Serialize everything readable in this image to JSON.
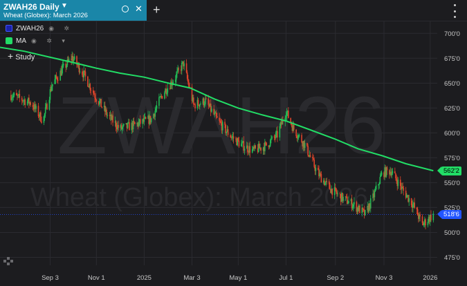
{
  "tab": {
    "title": "ZWAH26 Daily",
    "subtitle": "Wheat (Globex): March 2026",
    "caret": "▼",
    "close": "✕",
    "add": "+"
  },
  "legend": [
    {
      "label": "ZWAH26",
      "color": "#2233ee"
    },
    {
      "label": "MA",
      "color": "#22dd66"
    }
  ],
  "study_label": "Study",
  "watermark": {
    "symbol": "ZWAH26",
    "description": "Wheat (Globex): March 2026"
  },
  "badges": {
    "ma": {
      "value": "562'2",
      "color": "#22dd66"
    },
    "price": {
      "value": "518'6",
      "color": "#2255ff"
    }
  },
  "colors": {
    "up": "#22bb55",
    "down": "#e0452b",
    "ma": "#22dd66",
    "grid": "#2b2b30",
    "axis_text": "#c8c8c8"
  },
  "chart_data": {
    "type": "candlestick",
    "y_ticks": [
      "700'0",
      "675'0",
      "650'0",
      "625'0",
      "600'0",
      "575'0",
      "550'0",
      "525'0",
      "500'0",
      "475'0"
    ],
    "y_tick_values": [
      700,
      675,
      650,
      625,
      600,
      575,
      550,
      525,
      500,
      475
    ],
    "ylim": [
      467,
      712
    ],
    "x_ticks": [
      "Sep 3",
      "Nov 1",
      "2025",
      "Mar 3",
      "May 1",
      "Jul 1",
      "Sep 2",
      "Nov 3",
      "2026"
    ],
    "x_tick_dates": [
      "2024-09-03",
      "2024-11-01",
      "2025-01-01",
      "2025-03-03",
      "2025-05-01",
      "2025-07-01",
      "2025-09-02",
      "2025-11-03",
      "2026-01-01"
    ],
    "x_range": [
      "2024-07-01",
      "2026-01-10"
    ],
    "price_anchors": [
      [
        "2024-07-15",
        638
      ],
      [
        "2024-08-10",
        630
      ],
      [
        "2024-08-25",
        612
      ],
      [
        "2024-09-05",
        648
      ],
      [
        "2024-09-20",
        665
      ],
      [
        "2024-10-01",
        676
      ],
      [
        "2024-10-15",
        660
      ],
      [
        "2024-10-30",
        638
      ],
      [
        "2024-11-15",
        618
      ],
      [
        "2024-12-01",
        604
      ],
      [
        "2024-12-20",
        608
      ],
      [
        "2025-01-10",
        614
      ],
      [
        "2025-01-25",
        640
      ],
      [
        "2025-02-10",
        656
      ],
      [
        "2025-02-20",
        670
      ],
      [
        "2025-03-05",
        628
      ],
      [
        "2025-03-20",
        632
      ],
      [
        "2025-04-05",
        612
      ],
      [
        "2025-04-20",
        598
      ],
      [
        "2025-05-05",
        588
      ],
      [
        "2025-05-20",
        582
      ],
      [
        "2025-06-05",
        587
      ],
      [
        "2025-06-20",
        598
      ],
      [
        "2025-07-01",
        622
      ],
      [
        "2025-07-10",
        605
      ],
      [
        "2025-07-25",
        588
      ],
      [
        "2025-08-10",
        560
      ],
      [
        "2025-08-25",
        545
      ],
      [
        "2025-09-10",
        535
      ],
      [
        "2025-09-25",
        528
      ],
      [
        "2025-10-10",
        518
      ],
      [
        "2025-10-20",
        535
      ],
      [
        "2025-11-01",
        560
      ],
      [
        "2025-11-12",
        562
      ],
      [
        "2025-11-25",
        545
      ],
      [
        "2025-12-10",
        528
      ],
      [
        "2025-12-22",
        508
      ],
      [
        "2026-01-05",
        518
      ]
    ],
    "ma_points": [
      [
        "2024-07-01",
        686
      ],
      [
        "2024-08-01",
        682
      ],
      [
        "2024-09-03",
        676
      ],
      [
        "2024-10-01",
        671
      ],
      [
        "2024-11-01",
        665
      ],
      [
        "2024-12-01",
        660
      ],
      [
        "2025-01-01",
        656
      ],
      [
        "2025-02-01",
        650
      ],
      [
        "2025-03-01",
        645
      ],
      [
        "2025-04-01",
        634
      ],
      [
        "2025-05-01",
        625
      ],
      [
        "2025-06-01",
        618
      ],
      [
        "2025-07-01",
        612
      ],
      [
        "2025-08-01",
        603
      ],
      [
        "2025-09-01",
        594
      ],
      [
        "2025-10-01",
        584
      ],
      [
        "2025-11-01",
        577
      ],
      [
        "2025-12-01",
        569
      ],
      [
        "2026-01-05",
        562
      ]
    ],
    "last_price": "518'6",
    "ma_last": "562'2"
  }
}
